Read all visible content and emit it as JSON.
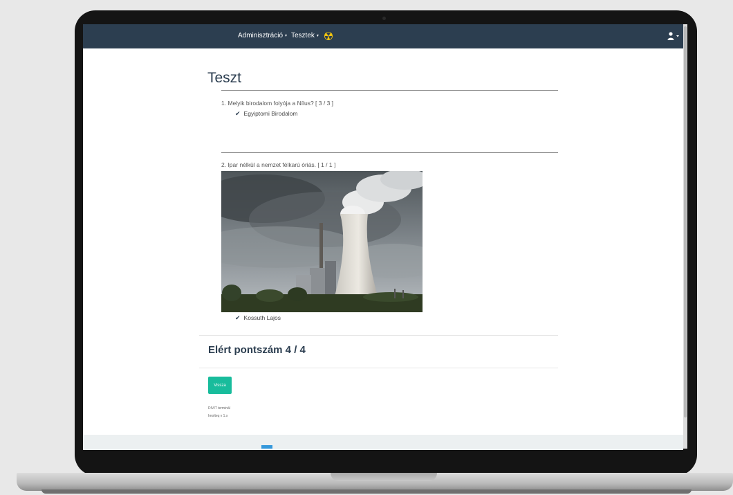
{
  "navbar": {
    "admin_label": "Adminisztráció",
    "tests_label": "Tesztek",
    "caret": "▾"
  },
  "page": {
    "title": "Teszt"
  },
  "questions": [
    {
      "text": "1. Melyik birodalom folyója a Nílus? [ 3 / 3 ]",
      "answer": "Egyiptomi Birodalom"
    },
    {
      "text": "2. Ipar nélkül a nemzet félkarú óriás. [ 1 / 1 ]",
      "answer": "Kossuth Lajos"
    }
  ],
  "icons": {
    "check": "✔",
    "radiation": "radiation-icon",
    "user": "user-icon"
  },
  "score_text": "Elért pontszám 4 / 4",
  "back_button_label": "Vissza",
  "footer": {
    "line1": "DIVIT terminál",
    "line2": "Imolteq v 1.x"
  },
  "colors": {
    "navbar": "#2c3e50",
    "accent": "#18bc9c",
    "radiation": "#f1c40f"
  }
}
